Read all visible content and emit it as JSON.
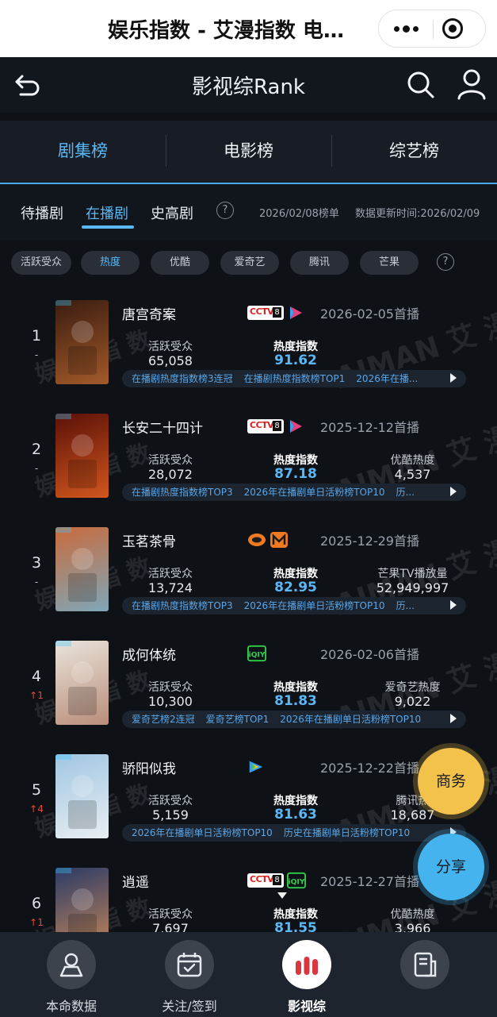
{
  "wechat": {
    "title": "娱乐指数 - 艾漫指数 电…"
  },
  "header": {
    "title": "影视综Rank"
  },
  "category_tabs": [
    {
      "label": "剧集榜",
      "active": true
    },
    {
      "label": "电影榜",
      "active": false
    },
    {
      "label": "综艺榜",
      "active": false
    }
  ],
  "sub_tabs": [
    {
      "label": "待播剧",
      "active": false
    },
    {
      "label": "在播剧",
      "active": true
    },
    {
      "label": "史高剧",
      "active": false
    }
  ],
  "help_glyph": "?",
  "list_date": "2026/02/08榜单",
  "update_time": "数据更新时间:2026/02/09",
  "filters": [
    {
      "label": "活跃受众",
      "active": false
    },
    {
      "label": "热度",
      "active": true
    },
    {
      "label": "优酷",
      "active": false
    },
    {
      "label": "爱奇艺",
      "active": false
    },
    {
      "label": "腾讯",
      "active": false
    },
    {
      "label": "芒果",
      "active": false
    }
  ],
  "watermark": "AIMAN 艾漫数据 娱乐指数",
  "shows": [
    {
      "rank": "1",
      "trend": "-",
      "trend_dir": "flat",
      "title": "唐宫奇案",
      "platforms": [
        "cctv8",
        "yangshipin"
      ],
      "premiere": "2026-02-05首播",
      "metric1_label": "活跃受众",
      "metric1_value": "65,058",
      "metric2_label": "热度指数",
      "metric2_value": "91.62",
      "metric3_label": "",
      "metric3_value": "",
      "tags": [
        "在播剧热度指数榜3连冠",
        "在播剧热度指数榜TOP1",
        "2026年在播..."
      ],
      "poster_colors": [
        "#3a1c10",
        "#a35a2a"
      ]
    },
    {
      "rank": "2",
      "trend": "-",
      "trend_dir": "flat",
      "title": "长安二十四计",
      "platforms": [
        "cctv8",
        "yangshipin"
      ],
      "premiere": "2025-12-12首播",
      "metric1_label": "活跃受众",
      "metric1_value": "28,072",
      "metric2_label": "热度指数",
      "metric2_value": "87.18",
      "metric3_label": "优酷热度",
      "metric3_value": "4,537",
      "tags": [
        "在播剧热度指数榜TOP3",
        "2026年在播剧单日活粉榜TOP10",
        "历..."
      ],
      "poster_colors": [
        "#5a1008",
        "#d2571d"
      ]
    },
    {
      "rank": "3",
      "trend": "-",
      "trend_dir": "flat",
      "title": "玉茗茶骨",
      "platforms": [
        "mangguo",
        "mango-tv"
      ],
      "premiere": "2025-12-29首播",
      "metric1_label": "活跃受众",
      "metric1_value": "13,724",
      "metric2_label": "热度指数",
      "metric2_value": "82.95",
      "metric3_label": "芒果TV播放量",
      "metric3_value": "52,949,997",
      "tags": [
        "在播剧热度指数榜TOP3",
        "2026年在播剧单日活粉榜TOP10",
        "历..."
      ],
      "poster_colors": [
        "#c96a3c",
        "#7fa7b8"
      ]
    },
    {
      "rank": "4",
      "trend": "↑1",
      "trend_dir": "up",
      "title": "成何体统",
      "platforms": [
        "iqiyi"
      ],
      "premiere": "2026-02-06首播",
      "metric1_label": "活跃受众",
      "metric1_value": "10,300",
      "metric2_label": "热度指数",
      "metric2_value": "81.83",
      "metric3_label": "爱奇艺热度",
      "metric3_value": "9,022",
      "tags": [
        "爱奇艺榜2连冠",
        "爱奇艺榜TOP1",
        "2026年在播剧单日活粉榜TOP10"
      ],
      "poster_colors": [
        "#e9e4dc",
        "#b98d7a"
      ]
    },
    {
      "rank": "5",
      "trend": "↑4",
      "trend_dir": "up",
      "title": "骄阳似我",
      "platforms": [
        "tencent"
      ],
      "premiere": "2025-12-22首播",
      "metric1_label": "活跃受众",
      "metric1_value": "5,159",
      "metric2_label": "热度指数",
      "metric2_value": "81.63",
      "metric3_label": "腾讯热",
      "metric3_value": "18,687",
      "tags": [
        "2026年在播剧单日活粉榜TOP10",
        "历史在播剧单日活粉榜TOP10"
      ],
      "poster_colors": [
        "#9fc6e2",
        "#e9eef2"
      ]
    },
    {
      "rank": "6",
      "trend": "↑1",
      "trend_dir": "up",
      "title": "逍遥",
      "platforms": [
        "cctv8",
        "iqiyi"
      ],
      "premiere": "2025-12-27首播",
      "metric1_label": "活跃受众",
      "metric1_value": "7,697",
      "metric2_label": "热度指数",
      "metric2_value": "81.55",
      "metric3_label": "优酷热度",
      "metric3_value": "3,966",
      "tags": [],
      "poster_colors": [
        "#2b3a66",
        "#c4875a"
      ]
    }
  ],
  "float_buttons": {
    "business": "商务",
    "share": "分享"
  },
  "tabbar": [
    {
      "label": "本命数据",
      "icon": "person-icon",
      "active": false
    },
    {
      "label": "关注/签到",
      "icon": "calendar-check-icon",
      "active": false
    },
    {
      "label": "影视综",
      "icon": "bar-chart-icon",
      "active": true
    },
    {
      "label": "",
      "icon": "document-icon",
      "active": false
    }
  ],
  "colors": {
    "accent": "#5ab8f7",
    "up": "#e04a3f",
    "business": "#f2c24b",
    "share": "#45b3ee"
  }
}
